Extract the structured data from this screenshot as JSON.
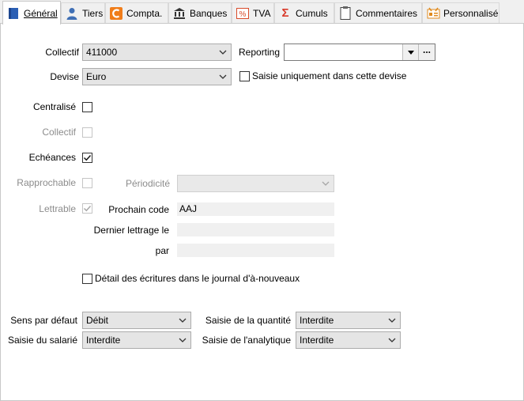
{
  "tabs": [
    {
      "label": "Général",
      "icon": "general-icon"
    },
    {
      "label": "Tiers",
      "icon": "person-icon"
    },
    {
      "label": "Compta.",
      "icon": "compta-icon"
    },
    {
      "label": "Banques",
      "icon": "bank-icon"
    },
    {
      "label": "TVA",
      "icon": "percent-icon"
    },
    {
      "label": "Cumuls",
      "icon": "sigma-icon"
    },
    {
      "label": "Commentaires",
      "icon": "note-icon"
    },
    {
      "label": "Personnalisé",
      "icon": "custom-icon"
    }
  ],
  "form": {
    "collectif_label": "Collectif",
    "collectif_value": "411000",
    "reporting_label": "Reporting",
    "reporting_value": "",
    "reporting_more": "...",
    "devise_label": "Devise",
    "devise_value": "Euro",
    "saisie_devise_label": "Saisie uniquement dans cette devise",
    "centralise_label": "Centralisé",
    "collectif2_label": "Collectif",
    "echeances_label": "Echéances",
    "rapprochable_label": "Rapprochable",
    "periodicite_label": "Périodicité",
    "lettrable_label": "Lettrable",
    "prochain_code_label": "Prochain code",
    "prochain_code_value": "AAJ",
    "dernier_lettrage_label": "Dernier lettrage le",
    "par_label": "par",
    "detail_label": "Détail des écritures dans le journal d'à-nouveaux",
    "sens_label": "Sens par défaut",
    "sens_value": "Débit",
    "saisie_salarie_label": "Saisie du salarié",
    "saisie_salarie_value": "Interdite",
    "saisie_quantite_label": "Saisie de la quantité",
    "saisie_quantite_value": "Interdite",
    "saisie_analytique_label": "Saisie de l'analytique",
    "saisie_analytique_value": "Interdite"
  },
  "checkboxes": {
    "saisie_devise": false,
    "centralise": false,
    "collectif": false,
    "echeances": true,
    "rapprochable": false,
    "lettrable": true,
    "detail": false
  },
  "colors": {
    "tab_general": "#2b5fb4",
    "tab_person": "#3f6fb5",
    "tab_compta": "#f07d1a",
    "tab_percent": "#d84b2a",
    "tab_sigma": "#d83a2a",
    "tab_custom": "#e08a1e"
  }
}
